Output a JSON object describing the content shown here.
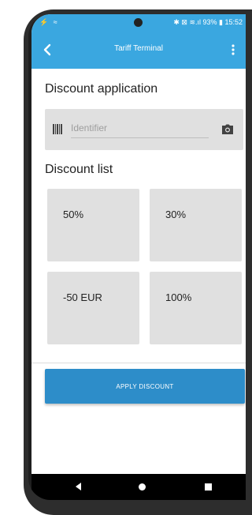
{
  "status_bar": {
    "left_icons": "⚡ ≈",
    "right_text": "✱ ⊠ ≋.ıl 93% ▮ 15:52"
  },
  "app_bar": {
    "title": "Tariff Terminal",
    "back_icon": "chevron-left-icon",
    "menu_icon": "more-vert-icon"
  },
  "discount_application": {
    "title": "Discount application",
    "identifier_placeholder": "Identifier",
    "identifier_value": ""
  },
  "discount_list": {
    "title": "Discount list",
    "items": [
      {
        "label": "50%"
      },
      {
        "label": "30%"
      },
      {
        "label": "-50 EUR"
      },
      {
        "label": "100%"
      }
    ]
  },
  "apply_button": {
    "label": "APPLY DISCOUNT"
  },
  "colors": {
    "app_bar": "#3aa7e0",
    "apply_button": "#2d8dc9",
    "tile": "#e0e0e0"
  }
}
